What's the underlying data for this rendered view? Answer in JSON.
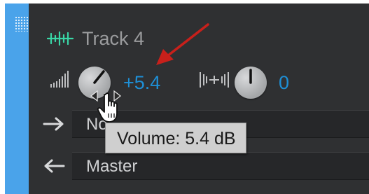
{
  "track": {
    "name": "Track 4",
    "volume": "+5.4",
    "pan": "0"
  },
  "routing": {
    "input_label": "No",
    "output_label": "Master"
  },
  "tooltip": {
    "text": "Volume: 5.4 dB"
  },
  "icons": {
    "grip": "grip-dots-icon",
    "track_type": "audio-waveform-icon",
    "volume": "volume-meter-icon",
    "pan": "pan-icon",
    "input": "arrow-right-icon",
    "output": "arrow-left-icon",
    "cursor": "hand-cursor-icon",
    "annotation": "red-arrow-icon"
  },
  "colors": {
    "selection_strip": "#4aa3ea",
    "panel_background": "#2f3032",
    "field_background": "#262729",
    "value_text": "#1e8fd6",
    "waveform": "#39d6a6",
    "annotation_arrow": "#c8201b",
    "tooltip_background": "#cfcfcf"
  }
}
